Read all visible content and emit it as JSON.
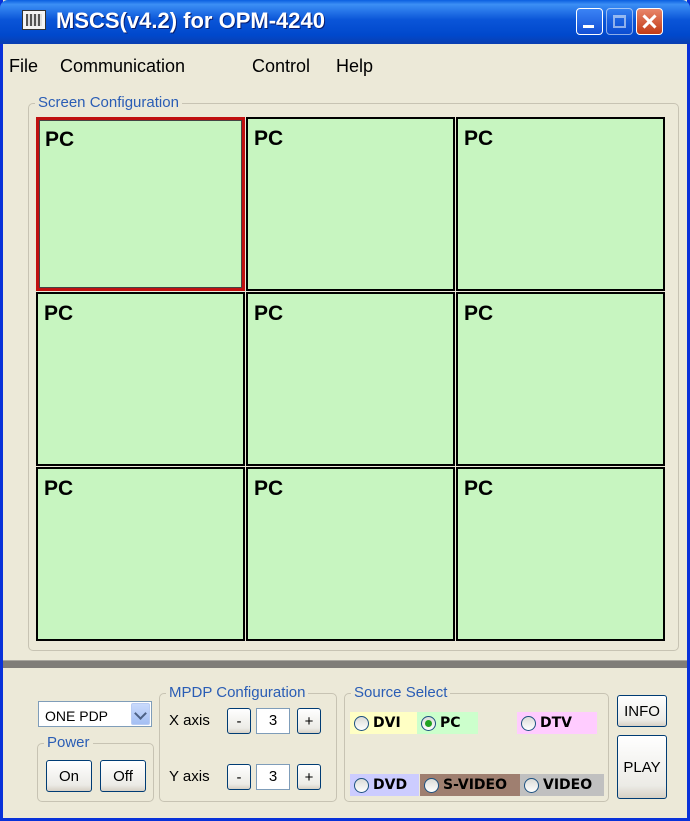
{
  "window": {
    "title": "MSCS(v4.2) for OPM-4240"
  },
  "menu": [
    "File",
    "Communication",
    "Control",
    "Help"
  ],
  "screen_config": {
    "legend": "Screen Configuration",
    "cells": [
      "PC",
      "PC",
      "PC",
      "PC",
      "PC",
      "PC",
      "PC",
      "PC",
      "PC"
    ],
    "selected_index": 0
  },
  "mode_select": {
    "value": "ONE PDP"
  },
  "power": {
    "legend": "Power",
    "on_label": "On",
    "off_label": "Off"
  },
  "mpdp": {
    "legend": "MPDP Configuration",
    "x_label": "X axis",
    "x_value": "3",
    "y_label": "Y axis",
    "y_value": "3",
    "minus": "-",
    "plus": "+"
  },
  "source": {
    "legend": "Source Select",
    "options": [
      {
        "label": "DVI",
        "selected": false,
        "bg": "#FFFFC4"
      },
      {
        "label": "PC",
        "selected": true,
        "bg": "#CCFFCC"
      },
      {
        "label": "DTV",
        "selected": false,
        "bg": "#FFCCFF"
      },
      {
        "label": "DVD",
        "selected": false,
        "bg": "#CCCCFF"
      },
      {
        "label": "S-VIDEO",
        "selected": false,
        "bg": "#9F7F70"
      },
      {
        "label": "VIDEO",
        "selected": false,
        "bg": "#C0C0C0"
      }
    ]
  },
  "buttons": {
    "info": "INFO",
    "play": "PLAY"
  },
  "colors": {
    "cell_bg": "#C7F5C0",
    "selected_border": "#C01010",
    "groupbox_legend": "#2A5DB5"
  }
}
